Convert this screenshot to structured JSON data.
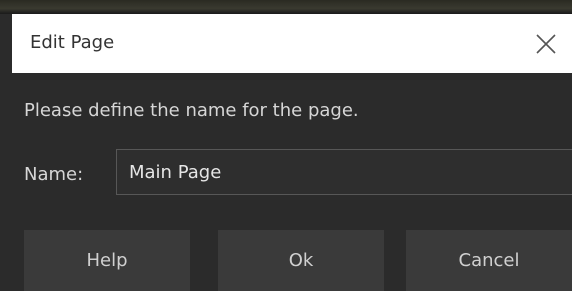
{
  "dialog": {
    "title": "Edit Page",
    "close_icon": "close-icon",
    "message": "Please define the name for the page.",
    "name_label": "Name:",
    "name_value": "Main Page",
    "buttons": {
      "help": "Help",
      "ok": "Ok",
      "cancel": "Cancel"
    }
  },
  "colors": {
    "titlebar_bg": "#ffffff",
    "dialog_bg": "#2b2b2b",
    "button_bg": "#3a3a3a",
    "text": "#d6d6d6"
  }
}
